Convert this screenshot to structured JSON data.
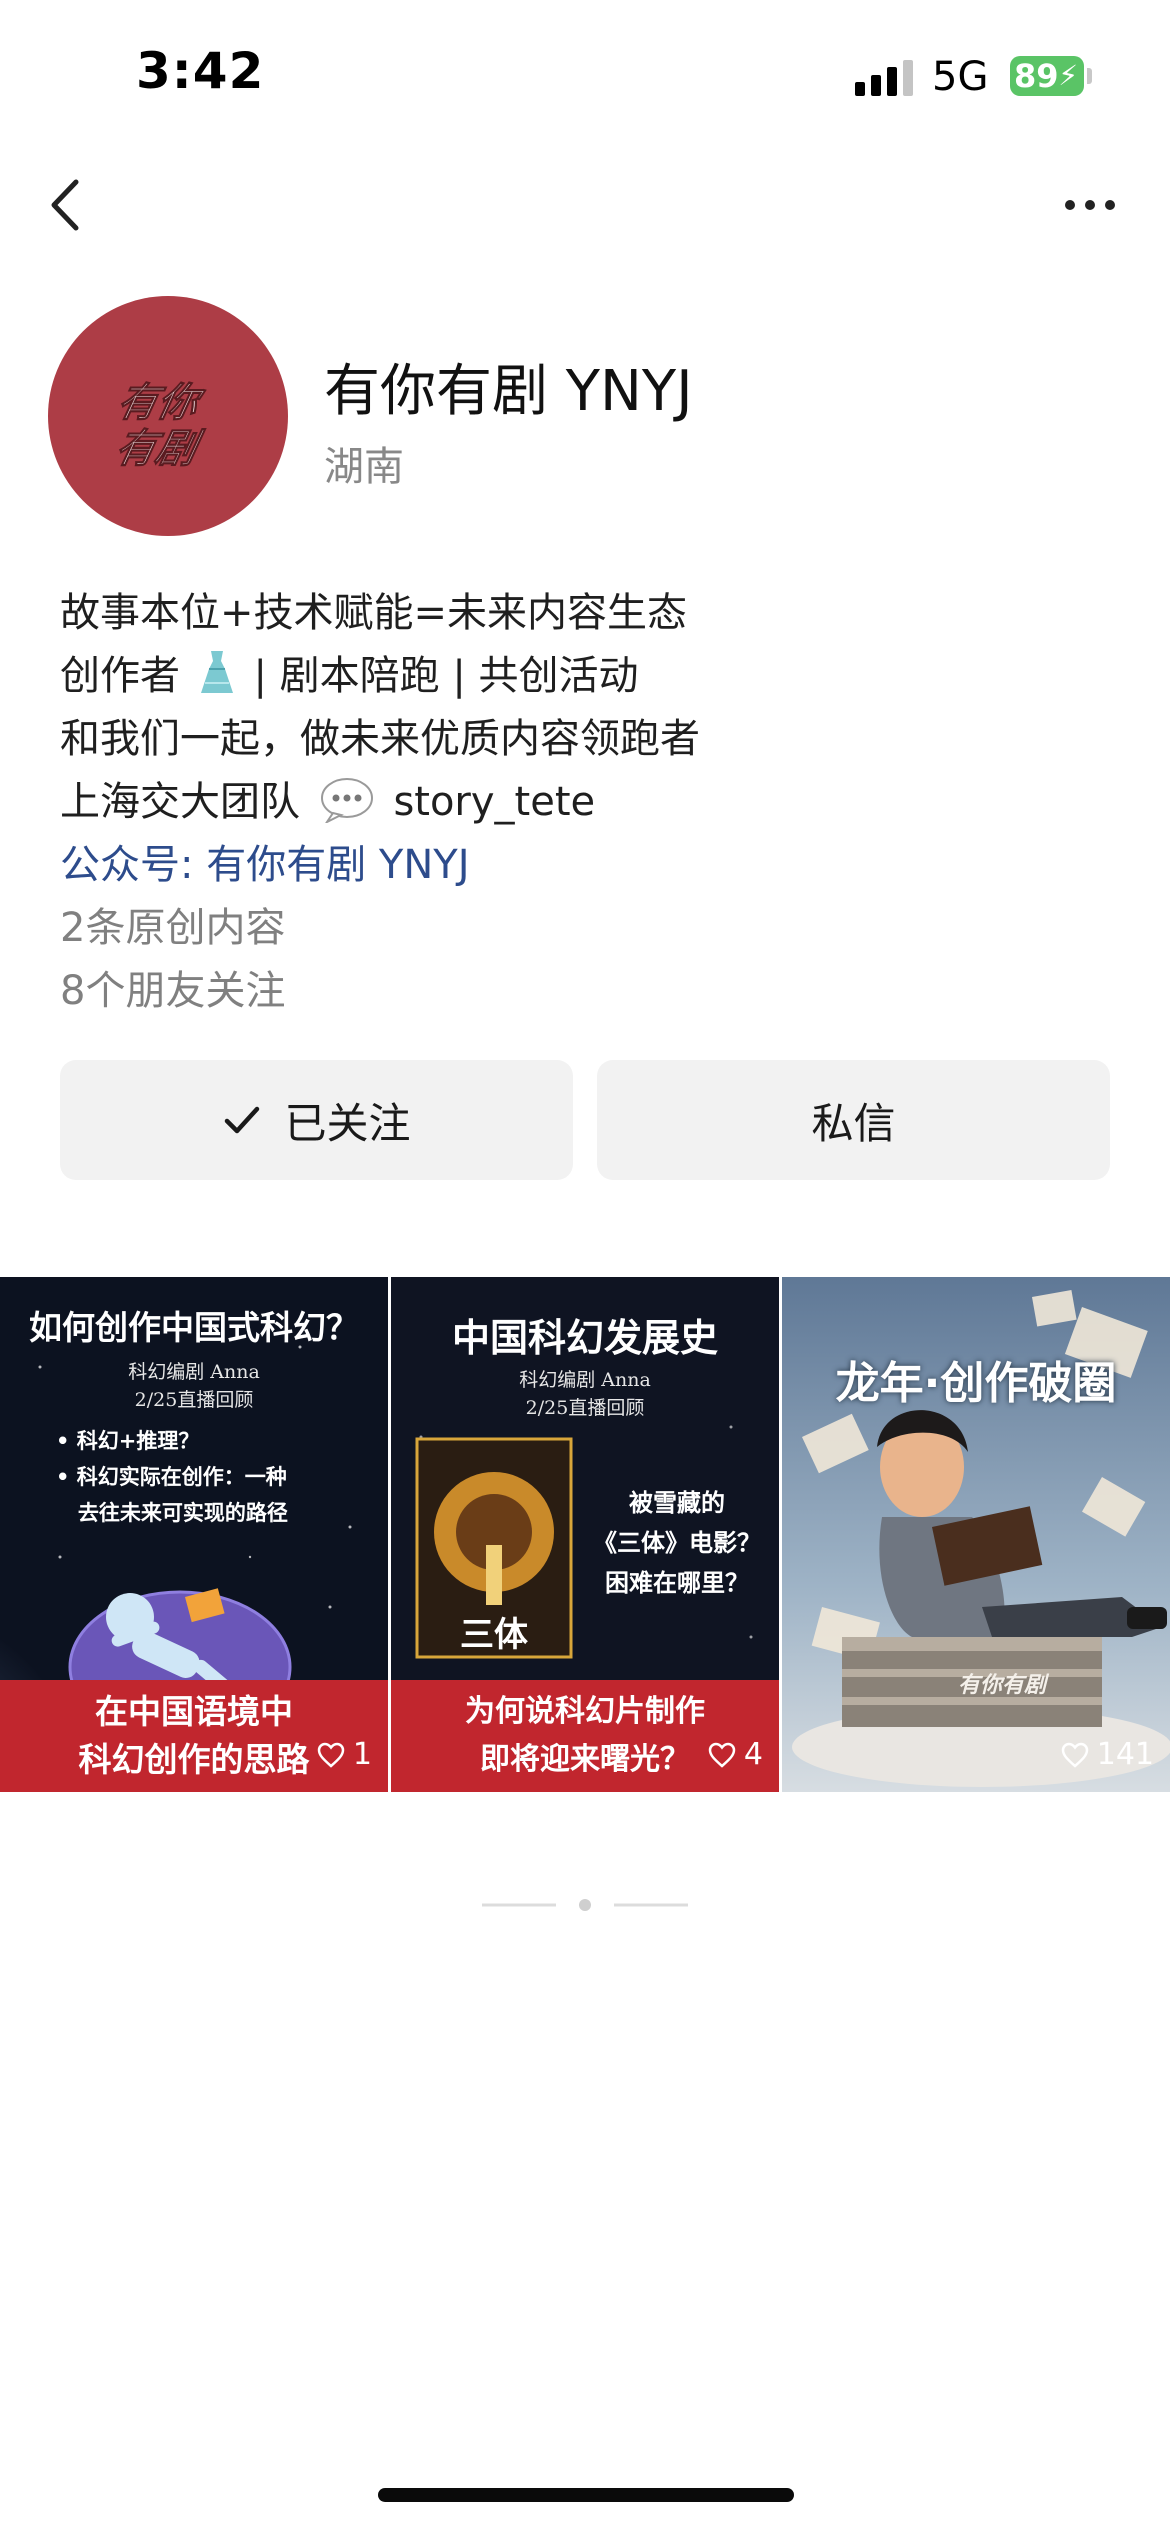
{
  "status_bar": {
    "time": "3:42",
    "network": "5G",
    "battery": "89"
  },
  "profile": {
    "name": "有你有剧 YNYJ",
    "location": "湖南",
    "avatar_text": "有你有剧"
  },
  "bio": {
    "line1": "故事本位+技术赋能=未来内容生态",
    "line2_a": "创作者",
    "line2_b": "| 剧本陪跑 | 共创活动",
    "line3": "和我们一起，做未来优质内容领跑者",
    "line4_a": "上海交大团队",
    "line4_b": "story_tete",
    "official_account": "公众号: 有你有剧 YNYJ",
    "original_count": "2条原创内容",
    "friends_following": "8个朋友关注"
  },
  "actions": {
    "follow_label": "已关注",
    "message_label": "私信"
  },
  "posts": [
    {
      "title": "如何创作中国式科幻？",
      "sub1": "科幻编剧  Anna",
      "sub2": "2/25直播回顾",
      "bullets": "• 科幻+推理？\n• 科幻实际在创作：一种\n   去往未来可实现的路径",
      "bottom": "在中国语境中\n科幻创作的思路",
      "likes": "1"
    },
    {
      "title": "中国科幻发展史",
      "sub1": "科幻编剧  Anna",
      "sub2": "2/25直播回顾",
      "side": "被雪藏的\n《三体》电影？\n困难在哪里？",
      "poster": "三体",
      "bottom": "为何说科幻片制作\n即将迎来曙光？",
      "likes": "4"
    },
    {
      "title": "龙年·创作破圈",
      "watermark": "有你有剧",
      "likes": "141"
    }
  ],
  "colors": {
    "link": "#2d4c8c",
    "avatar_bg": "#ad3d46",
    "banner_red": "#c1262e"
  }
}
